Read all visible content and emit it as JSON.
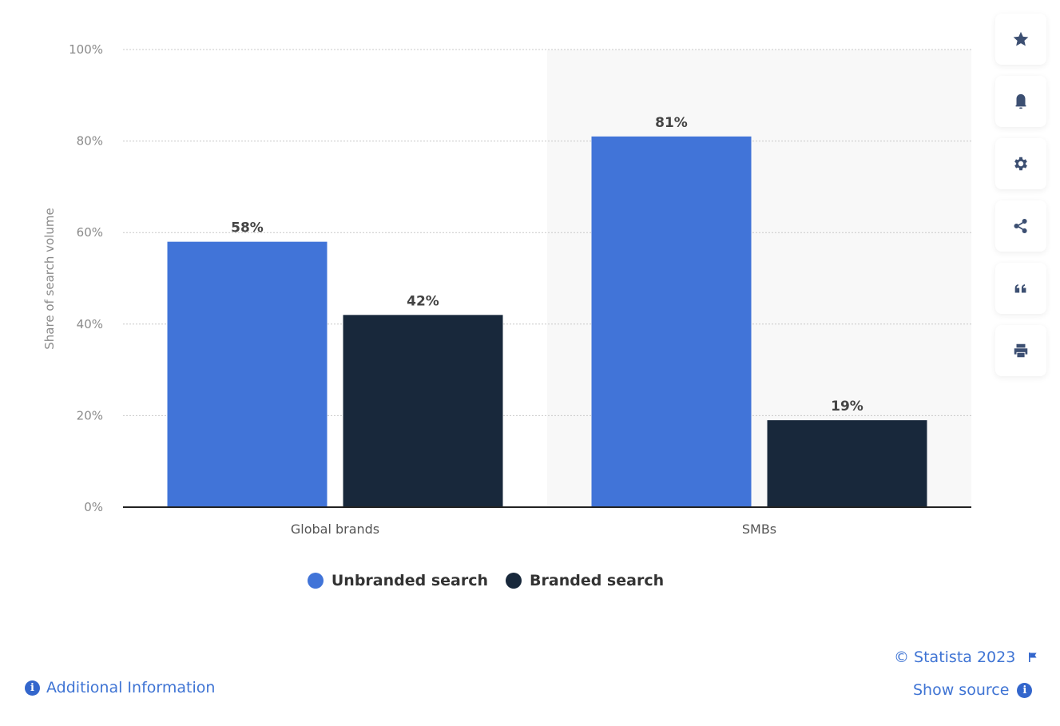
{
  "chart_data": {
    "type": "bar",
    "title": "",
    "xlabel": "",
    "ylabel": "Share of search volume",
    "categories": [
      "Global brands",
      "SMBs"
    ],
    "series": [
      {
        "name": "Unbranded search",
        "color": "#4174d8",
        "values": [
          58,
          81
        ],
        "labels": [
          "58%",
          "81%"
        ]
      },
      {
        "name": "Branded search",
        "color": "#18283b",
        "values": [
          42,
          19
        ],
        "labels": [
          "42%",
          "19%"
        ]
      }
    ],
    "ylim": [
      0,
      100
    ],
    "yticks": [
      0,
      20,
      40,
      60,
      80,
      100
    ],
    "ytick_labels": [
      "0%",
      "20%",
      "40%",
      "60%",
      "80%",
      "100%"
    ],
    "grid": true,
    "highlighted_category": "SMBs",
    "legend": "bottom-center"
  },
  "legend": {
    "items": [
      {
        "label": "Unbranded search",
        "color": "#4174d8"
      },
      {
        "label": "Branded search",
        "color": "#18283b"
      }
    ]
  },
  "toolbar": {
    "items": [
      {
        "name": "favorite",
        "icon": "star-icon"
      },
      {
        "name": "notification",
        "icon": "bell-icon"
      },
      {
        "name": "settings",
        "icon": "gear-icon"
      },
      {
        "name": "share",
        "icon": "share-icon"
      },
      {
        "name": "cite",
        "icon": "quote-icon"
      },
      {
        "name": "print",
        "icon": "printer-icon"
      }
    ]
  },
  "footer": {
    "additional_info": "Additional Information",
    "copyright": "© Statista 2023",
    "show_source": "Show source",
    "info_glyph": "i"
  }
}
